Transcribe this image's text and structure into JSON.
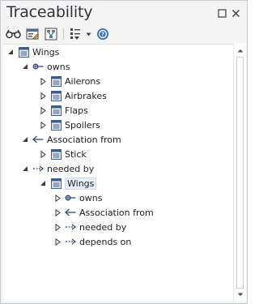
{
  "window": {
    "title": "Traceability"
  },
  "toolbar": {
    "buttons": [
      {
        "name": "locate-icon"
      },
      {
        "name": "properties-icon"
      },
      {
        "name": "diagram-icon"
      },
      {
        "name": "filter-icon"
      },
      {
        "name": "dropdown-arrow-icon"
      },
      {
        "name": "help-icon"
      }
    ]
  },
  "tree": {
    "root": "Wings",
    "owns": "owns",
    "owns_children": [
      "Ailerons",
      "Airbrakes",
      "Flaps",
      "Spoilers"
    ],
    "association_from": "Association from",
    "association_children": [
      "Stick"
    ],
    "needed_by": "needed by",
    "needed_by_child": "Wings",
    "needed_by_child_items": [
      "owns",
      "Association from",
      "needed by",
      "depends on"
    ]
  }
}
